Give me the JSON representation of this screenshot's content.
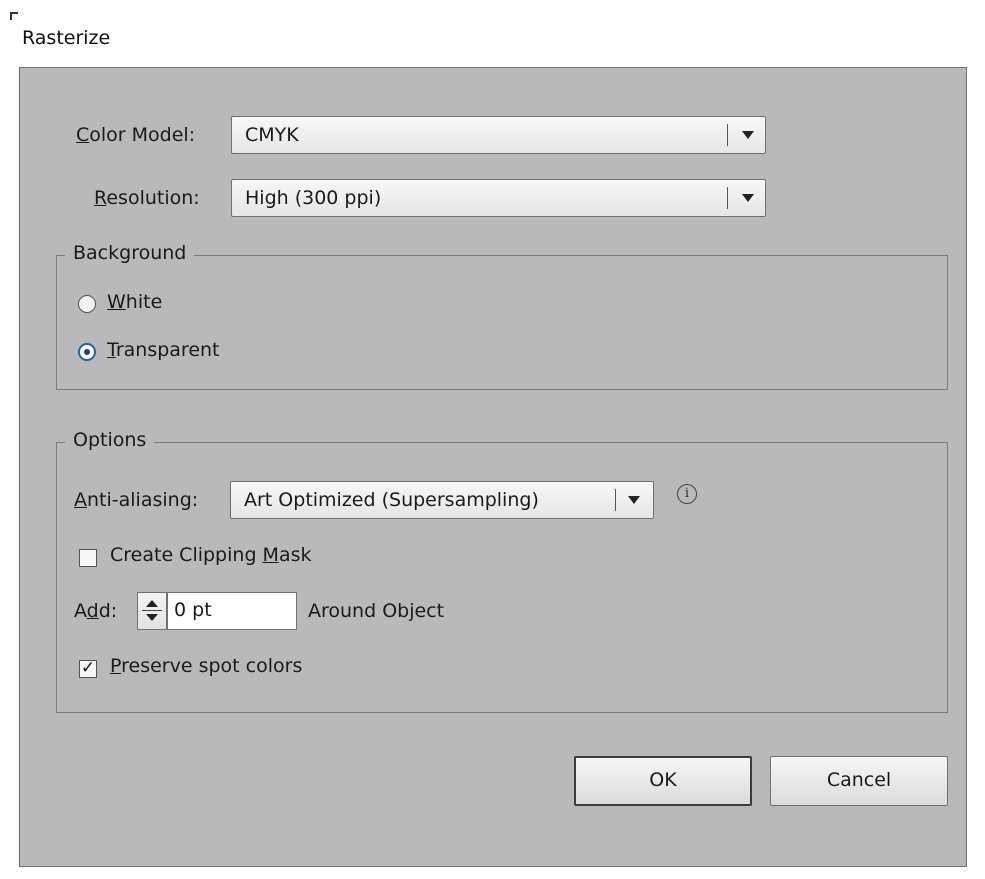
{
  "window": {
    "title": "Rasterize"
  },
  "color_model": {
    "label_mnemonic": "C",
    "label_rest": "olor Model:",
    "value": "CMYK"
  },
  "resolution": {
    "label_mnemonic": "R",
    "label_rest": "esolution:",
    "value": "High (300 ppi)"
  },
  "background": {
    "legend": "Background",
    "options": [
      {
        "mnemonic": "W",
        "rest": "hite",
        "selected": false
      },
      {
        "mnemonic": "T",
        "rest": "ransparent",
        "selected": true
      }
    ]
  },
  "options": {
    "legend": "Options",
    "anti_aliasing": {
      "label_mnemonic": "A",
      "label_rest": "nti-aliasing:",
      "value": "Art Optimized (Supersampling)",
      "info_glyph": "i"
    },
    "clipping_mask": {
      "label_before": "Create Clipping ",
      "label_mnemonic": "M",
      "label_after": "ask",
      "checked": false
    },
    "add": {
      "label_before": "A",
      "label_mnemonic": "d",
      "label_after": "d:",
      "value": "0 pt",
      "suffix": "Around Object"
    },
    "preserve_spot": {
      "label_mnemonic": "P",
      "label_rest": "reserve spot colors",
      "checked": true,
      "check_glyph": "✓"
    }
  },
  "buttons": {
    "ok": "OK",
    "cancel": "Cancel"
  },
  "colors": {
    "dialog_body": "#b9b9b9",
    "radio_selected": "#2a5db0"
  }
}
